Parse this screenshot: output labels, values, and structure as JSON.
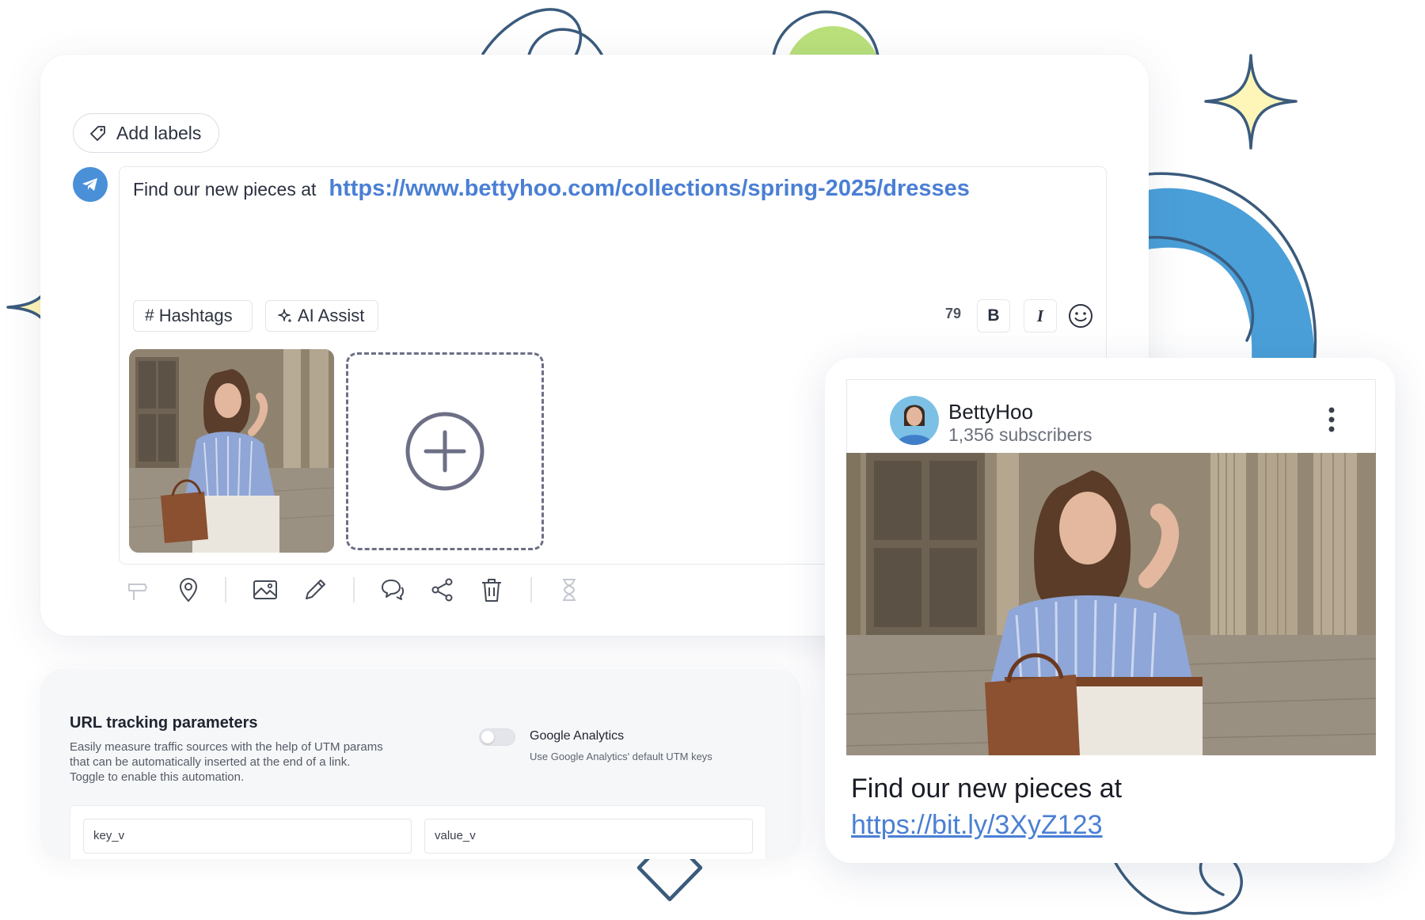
{
  "editor": {
    "add_labels": "Add labels",
    "post_text": "Find our new pieces at",
    "post_link": "https://www.bettyhoo.com/collections/spring-2025/dresses",
    "hashtags_label": "Hashtags",
    "ai_assist_label": "AI Assist",
    "char_count": "79",
    "bold_label": "B",
    "italic_label": "I",
    "icons": [
      "tag-icon",
      "telegram-icon",
      "hash-icon",
      "sparkle-icon",
      "smiley-icon",
      "add-media-icon",
      "pin-icon",
      "location-icon",
      "image-icon",
      "pencil-icon",
      "comment-icon",
      "share-icon",
      "trash-icon",
      "hourglass-icon"
    ]
  },
  "tracking": {
    "title": "URL tracking parameters",
    "description": "Easily measure traffic sources with the help of UTM params that can be automatically inserted at the end of a link. Toggle to enable this automation.",
    "toggle_label": "Google Analytics",
    "toggle_sublabel": "Use Google Analytics' default UTM keys",
    "toggle_on": false,
    "key_placeholder": "key_v",
    "value_placeholder": "value_v"
  },
  "preview": {
    "channel_name": "BettyHoo",
    "subscribers": "1,356 subscribers",
    "text": "Find our new pieces at",
    "link": "https://bit.ly/3XyZ123"
  },
  "colors": {
    "link": "#4a7fd4",
    "telegram": "#4a90d9",
    "accent_green": "#b9e07a",
    "accent_blue": "#4a9fd8",
    "star_fill": "#fdf6b8",
    "navy_line": "#3b5b7d"
  }
}
